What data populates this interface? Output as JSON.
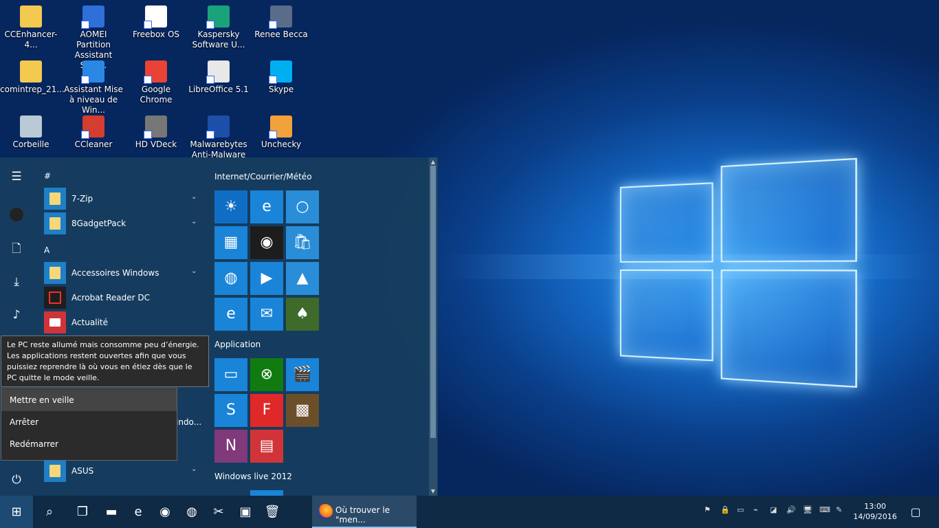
{
  "desktop": {
    "icons": [
      {
        "label": "CCEnhancer-4...",
        "icon": "folder-icon",
        "color": "#f3c94f"
      },
      {
        "label": "AOMEI Partition Assistant Stan...",
        "icon": "aomei-icon",
        "color": "#2f6fd8"
      },
      {
        "label": "Freebox OS",
        "icon": "freebox-icon",
        "color": "#ffffff"
      },
      {
        "label": "Kaspersky Software U...",
        "icon": "kaspersky-icon",
        "color": "#1aa37a"
      },
      {
        "label": "Renee Becca",
        "icon": "renee-becca-icon",
        "color": "#5a6c8a"
      },
      {
        "label": "comintrep_21...",
        "icon": "folder-icon",
        "color": "#f3c94f"
      },
      {
        "label": "Assistant Mise à niveau de Win...",
        "icon": "windows-update-icon",
        "color": "#2a88e4"
      },
      {
        "label": "Google Chrome",
        "icon": "chrome-icon",
        "color": "#e94335"
      },
      {
        "label": "LibreOffice 5.1",
        "icon": "libreoffice-icon",
        "color": "#e8e8e8"
      },
      {
        "label": "Skype",
        "icon": "skype-icon",
        "color": "#00aff0"
      },
      {
        "label": "Corbeille",
        "icon": "recycle-bin-icon",
        "color": "#b9c9d6"
      },
      {
        "label": "CCleaner",
        "icon": "ccleaner-icon",
        "color": "#d43d2f"
      },
      {
        "label": "HD VDeck",
        "icon": "hd-vdeck-icon",
        "color": "#777777"
      },
      {
        "label": "Malwarebytes Anti-Malware",
        "icon": "malwarebytes-icon",
        "color": "#1d4fa8"
      },
      {
        "label": "Unchecky",
        "icon": "unchecky-icon",
        "color": "#f2a23a"
      }
    ]
  },
  "start": {
    "rail": [
      {
        "icon": "hamburger-icon",
        "glyph": "☰"
      },
      {
        "icon": "user-avatar-icon",
        "glyph": "●"
      },
      {
        "icon": "documents-icon",
        "glyph": "🗋"
      },
      {
        "icon": "downloads-icon",
        "glyph": "⤓"
      },
      {
        "icon": "music-icon",
        "glyph": "♪"
      },
      {
        "icon": "power-icon",
        "glyph": "⏻"
      }
    ],
    "headers": {
      "hash": "#",
      "a": "A"
    },
    "apps": [
      {
        "label": "7-Zip",
        "chevron": "⌄"
      },
      {
        "label": "8GadgetPack",
        "chevron": "⌄"
      },
      {
        "label": "Accessoires Windows",
        "chevron": "⌄"
      },
      {
        "label": "Acrobat Reader DC",
        "chevron": ""
      },
      {
        "label": "Actualité",
        "chevron": ""
      },
      {
        "label": "ASUS",
        "chevron": "⌄"
      }
    ],
    "hidden_fragment": "indo...",
    "groups": {
      "g1": "Internet/Courrier/Météo",
      "g2": "Application",
      "g3": "Windows live 2012"
    },
    "tiles_g1": [
      {
        "icon": "weather-icon",
        "glyph": "☀",
        "color": "#0f6ec4"
      },
      {
        "icon": "edge-icon",
        "glyph": "e",
        "color": "#1a84d8"
      },
      {
        "icon": "cortana-icon",
        "glyph": "○",
        "color": "#2a8dd8"
      },
      {
        "icon": "calendar-icon",
        "glyph": "▦",
        "color": "#1a84d8"
      },
      {
        "icon": "chrome-icon",
        "glyph": "◉",
        "color": "#1d1d1d"
      },
      {
        "icon": "store-icon",
        "glyph": "🛍",
        "color": "#2a8dd8"
      },
      {
        "icon": "firefox-icon",
        "glyph": "◍",
        "color": "#1a84d8"
      },
      {
        "icon": "media-player-icon",
        "glyph": "▶",
        "color": "#1a84d8"
      },
      {
        "icon": "photos-icon",
        "glyph": "▲",
        "color": "#2a8dd8"
      },
      {
        "icon": "internet-explorer-icon",
        "glyph": "e",
        "color": "#1a84d8"
      },
      {
        "icon": "mail-icon",
        "glyph": "✉",
        "color": "#1a84d8"
      },
      {
        "icon": "solitaire-icon",
        "glyph": "♠",
        "color": "#3f6b2a"
      }
    ],
    "tiles_g2": [
      {
        "icon": "connect-icon",
        "glyph": "▭",
        "color": "#1a84d8"
      },
      {
        "icon": "xbox-icon",
        "glyph": "⊗",
        "color": "#107c10"
      },
      {
        "icon": "movies-icon",
        "glyph": "🎬",
        "color": "#1a84d8"
      },
      {
        "icon": "shazam-icon",
        "glyph": "S",
        "color": "#1a84d8"
      },
      {
        "icon": "flipboard-icon",
        "glyph": "F",
        "color": "#e12828"
      },
      {
        "icon": "minecraft-icon",
        "glyph": "▩",
        "color": "#6b4f2a"
      },
      {
        "icon": "onenote-icon",
        "glyph": "N",
        "color": "#80397b"
      },
      {
        "icon": "news-icon",
        "glyph": "▤",
        "color": "#d13438"
      }
    ],
    "tooltip": "Le PC reste allumé mais consomme peu d’énergie. Les applications restent ouvertes afin que vous puissiez reprendre là où vous en étiez dès que le PC quitte le mode veille.",
    "power_menu": [
      "Mettre en veille",
      "Arrêter",
      "Redémarrer"
    ]
  },
  "taskbar": {
    "start_icon": "⊞",
    "search_icon": "⌕",
    "taskview_icon": "❐",
    "pinned": [
      {
        "icon": "desktop-icon",
        "glyph": "▬"
      },
      {
        "icon": "internet-explorer-icon",
        "glyph": "e"
      },
      {
        "icon": "chrome-icon",
        "glyph": "◉"
      },
      {
        "icon": "firefox-icon",
        "glyph": "◍"
      },
      {
        "icon": "snipping-tool-icon",
        "glyph": "✂"
      },
      {
        "icon": "photo-viewer-icon",
        "glyph": "▣"
      },
      {
        "icon": "recycle-bin-icon",
        "glyph": "🗑"
      }
    ],
    "active_window": "Où trouver le \"men...",
    "tray": [
      {
        "icon": "security-flag-icon",
        "glyph": "⚑"
      },
      {
        "icon": "lock-icon",
        "glyph": "🔒"
      },
      {
        "icon": "battery-icon",
        "glyph": "▭"
      },
      {
        "icon": "usb-icon",
        "glyph": "⌁"
      },
      {
        "icon": "nvidia-icon",
        "glyph": "◪"
      },
      {
        "icon": "volume-icon",
        "glyph": "🔊"
      },
      {
        "icon": "network-icon",
        "glyph": "🖥"
      },
      {
        "icon": "keyboard-icon",
        "glyph": "⌨"
      },
      {
        "icon": "pen-icon",
        "glyph": "✎"
      }
    ],
    "time": "13:00",
    "date": "14/09/2016",
    "notification_icon": "▢"
  }
}
